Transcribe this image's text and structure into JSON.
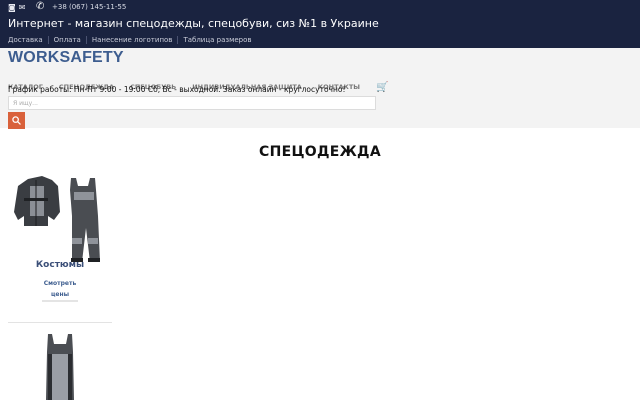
{
  "topbar": {
    "phone": "+38 (067) 145-11-55",
    "heading": "Интернет - магазин спецодежды, спецобуви, сиз №1 в Украине",
    "links": [
      "Доставка",
      "Оплата",
      "Нанесение логотипов",
      "Таблица размеров"
    ],
    "icons": [
      "instagram-icon",
      "email-icon",
      "phone-icon"
    ]
  },
  "header": {
    "logo": "WORKSAFETY",
    "nav": [
      "КАТАЛОГ",
      "СПЕЦОДЕЖДА",
      "СПЕЦОБУВЬ",
      "ИНДИВИДУАЛЬНАЯ ЗАЩИТА",
      "КОНТАКТЫ"
    ],
    "hours": "График работы: Пн-Пт 9:00 - 19:00 Сб, Вс - выходной. Заказ онлайн - круглосуточно!",
    "search_placeholder": "Я ищу..."
  },
  "main": {
    "title": "СПЕЦОДЕЖДА",
    "products": [
      {
        "name": "Костюмы",
        "link": "Смотреть цены"
      }
    ]
  },
  "colors": {
    "topbar_bg": "#1a2340",
    "logo": "#3d5d8f",
    "search_button": "#d9613b",
    "header_bg": "#f3f3f3"
  }
}
